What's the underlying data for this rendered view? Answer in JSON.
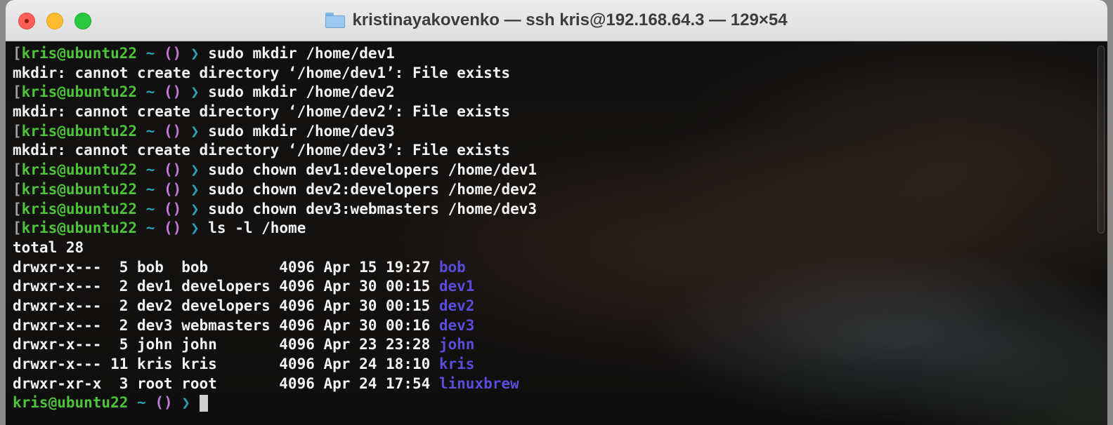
{
  "window": {
    "title": "kristinayakovenko — ssh kris@192.168.64.3 — 129×54",
    "icon": "folder-icon"
  },
  "prompt": {
    "user_host": "kris@ubuntu22",
    "tilde": "~",
    "git_symbol": "()",
    "arrow": "❯"
  },
  "colors": {
    "user": "#4ec33a",
    "tilde": "#2aa1b3",
    "git": "#c678dd",
    "directory": "#5b4bdb",
    "text": "#f2f2f2"
  },
  "lines": [
    {
      "type": "prompt",
      "bracket": "[",
      "cmd": "sudo mkdir /home/dev1"
    },
    {
      "type": "output",
      "text": "mkdir: cannot create directory ‘/home/dev1’: File exists"
    },
    {
      "type": "prompt",
      "bracket": "[",
      "cmd": "sudo mkdir /home/dev2"
    },
    {
      "type": "output",
      "text": "mkdir: cannot create directory ‘/home/dev2’: File exists"
    },
    {
      "type": "prompt",
      "bracket": "[",
      "cmd": "sudo mkdir /home/dev3"
    },
    {
      "type": "output",
      "text": "mkdir: cannot create directory ‘/home/dev3’: File exists"
    },
    {
      "type": "prompt",
      "bracket": "[",
      "cmd": "sudo chown dev1:developers /home/dev1"
    },
    {
      "type": "prompt",
      "bracket": "[",
      "cmd": "sudo chown dev2:developers /home/dev2"
    },
    {
      "type": "prompt",
      "bracket": "[",
      "cmd": "sudo chown dev3:webmasters /home/dev3"
    },
    {
      "type": "prompt",
      "bracket": "[",
      "cmd": "ls -l /home"
    },
    {
      "type": "output",
      "text": "total 28"
    },
    {
      "type": "listing",
      "text": "drwxr-x---  5 bob  bob        4096 Apr 15 19:27 ",
      "name": "bob"
    },
    {
      "type": "listing",
      "text": "drwxr-x---  2 dev1 developers 4096 Apr 30 00:15 ",
      "name": "dev1"
    },
    {
      "type": "listing",
      "text": "drwxr-x---  2 dev2 developers 4096 Apr 30 00:15 ",
      "name": "dev2"
    },
    {
      "type": "listing",
      "text": "drwxr-x---  2 dev3 webmasters 4096 Apr 30 00:16 ",
      "name": "dev3"
    },
    {
      "type": "listing",
      "text": "drwxr-x---  5 john john       4096 Apr 23 23:28 ",
      "name": "john"
    },
    {
      "type": "listing",
      "text": "drwxr-x--- 11 kris kris       4096 Apr 24 18:10 ",
      "name": "kris"
    },
    {
      "type": "listing",
      "text": "drwxr-xr-x  3 root root       4096 Apr 24 17:54 ",
      "name": "linuxbrew"
    },
    {
      "type": "prompt",
      "bracket": "",
      "cmd": "",
      "cursor": true
    }
  ]
}
